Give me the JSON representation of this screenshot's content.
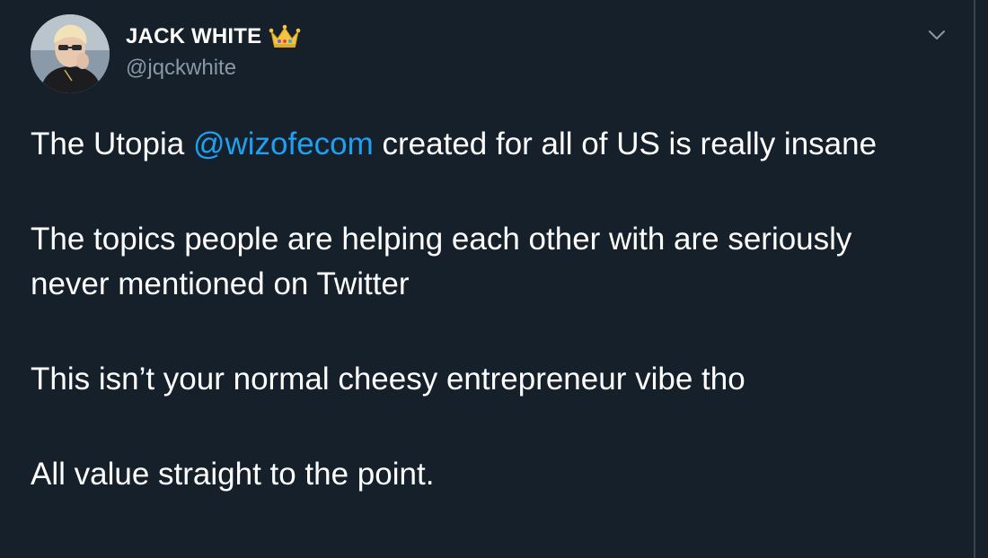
{
  "author": {
    "display_name": "JACK WHITE",
    "handle": "@jqckwhite",
    "badge_icon": "crown-icon"
  },
  "menu": {
    "icon": "chevron-down-icon"
  },
  "tweet": {
    "p1_before": "The Utopia ",
    "p1_mention": "@wizofecom",
    "p1_after": " created for all of US is really insane",
    "p2": "The topics people are helping each other with are seriously never mentioned on Twitter",
    "p3": "This isn’t your normal cheesy entrepreneur vibe tho",
    "p4": "All value straight to the point."
  },
  "colors": {
    "background": "#15202b",
    "text": "#ffffff",
    "secondary_text": "#8899a6",
    "mention": "#1da1f2",
    "border": "#38444d"
  }
}
